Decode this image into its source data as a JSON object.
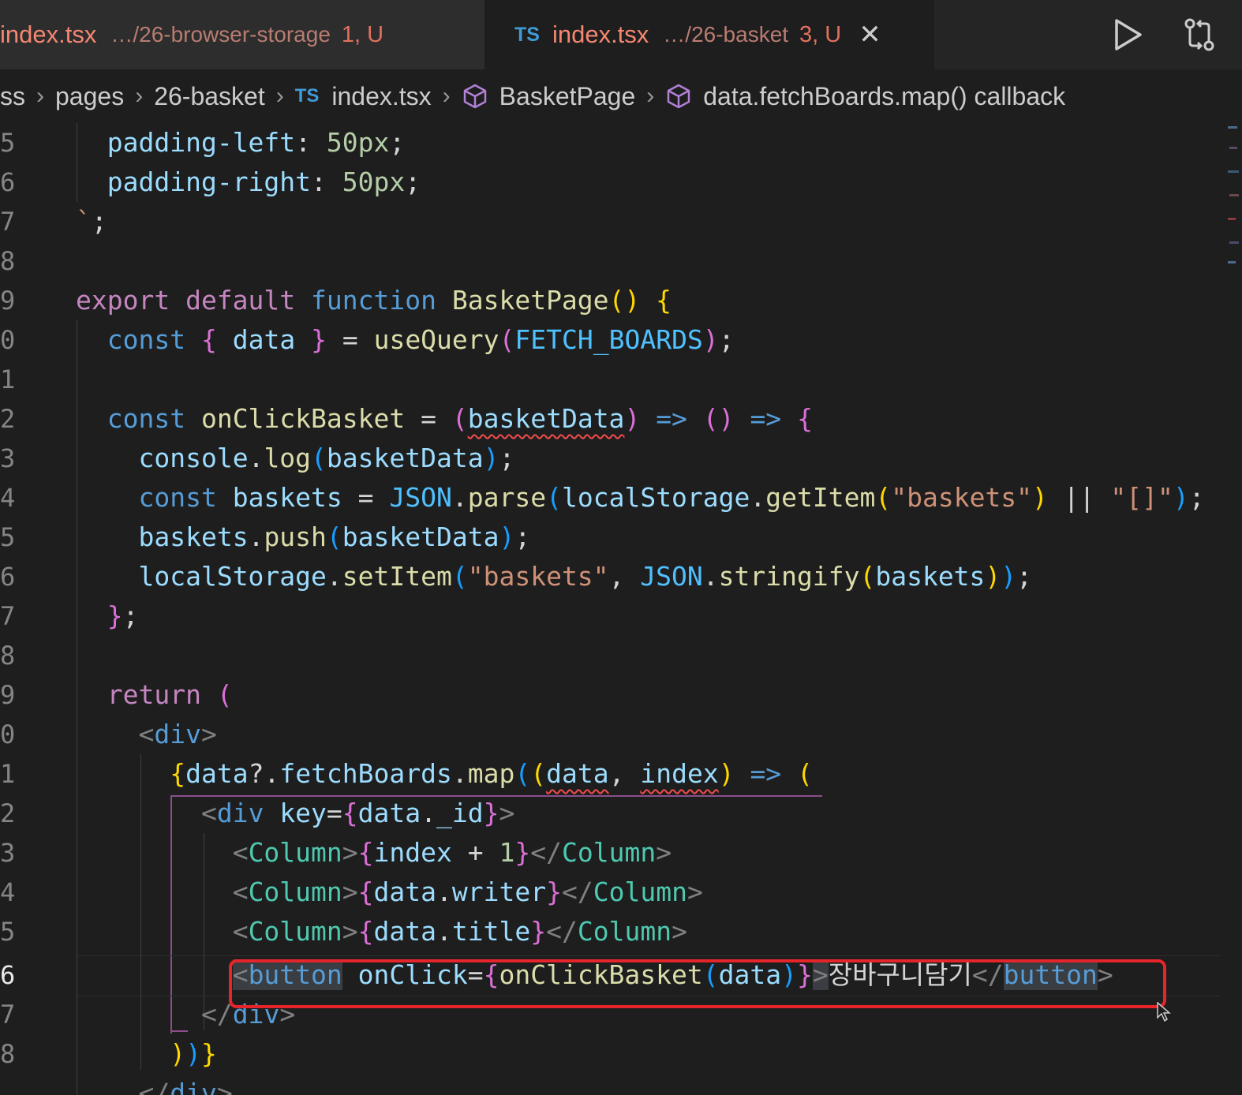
{
  "tabs": [
    {
      "name": "index.tsx",
      "path": "…/26-browser-storage",
      "status": "1, U",
      "active": false
    },
    {
      "badge": "TS",
      "name": "index.tsx",
      "path": "…/26-basket",
      "status": "3, U",
      "active": true,
      "close": "✕"
    }
  ],
  "toolbar": {
    "run_icon": "play-icon",
    "compare_icon": "source-compare-icon"
  },
  "breadcrumb": {
    "items": [
      "ss",
      "pages",
      "26-basket",
      "index.tsx",
      "BasketPage",
      "data.fetchBoards.map() callback"
    ],
    "ts_badge": "TS",
    "separator": "›"
  },
  "editor": {
    "line_numbers": [
      "5",
      "6",
      "7",
      "8",
      "9",
      "0",
      "1",
      "2",
      "3",
      "4",
      "5",
      "6",
      "7",
      "8",
      "9",
      "0",
      "1",
      "2",
      "3",
      "4",
      "5",
      "6",
      "7",
      "8"
    ],
    "current_line_index": 21,
    "korean_label": "장바구니담기"
  },
  "colors": {
    "highlight_box": "#e5252a",
    "background": "#1e1e1e",
    "accent_blue": "#569cd6",
    "keyword": "#c586c0"
  }
}
